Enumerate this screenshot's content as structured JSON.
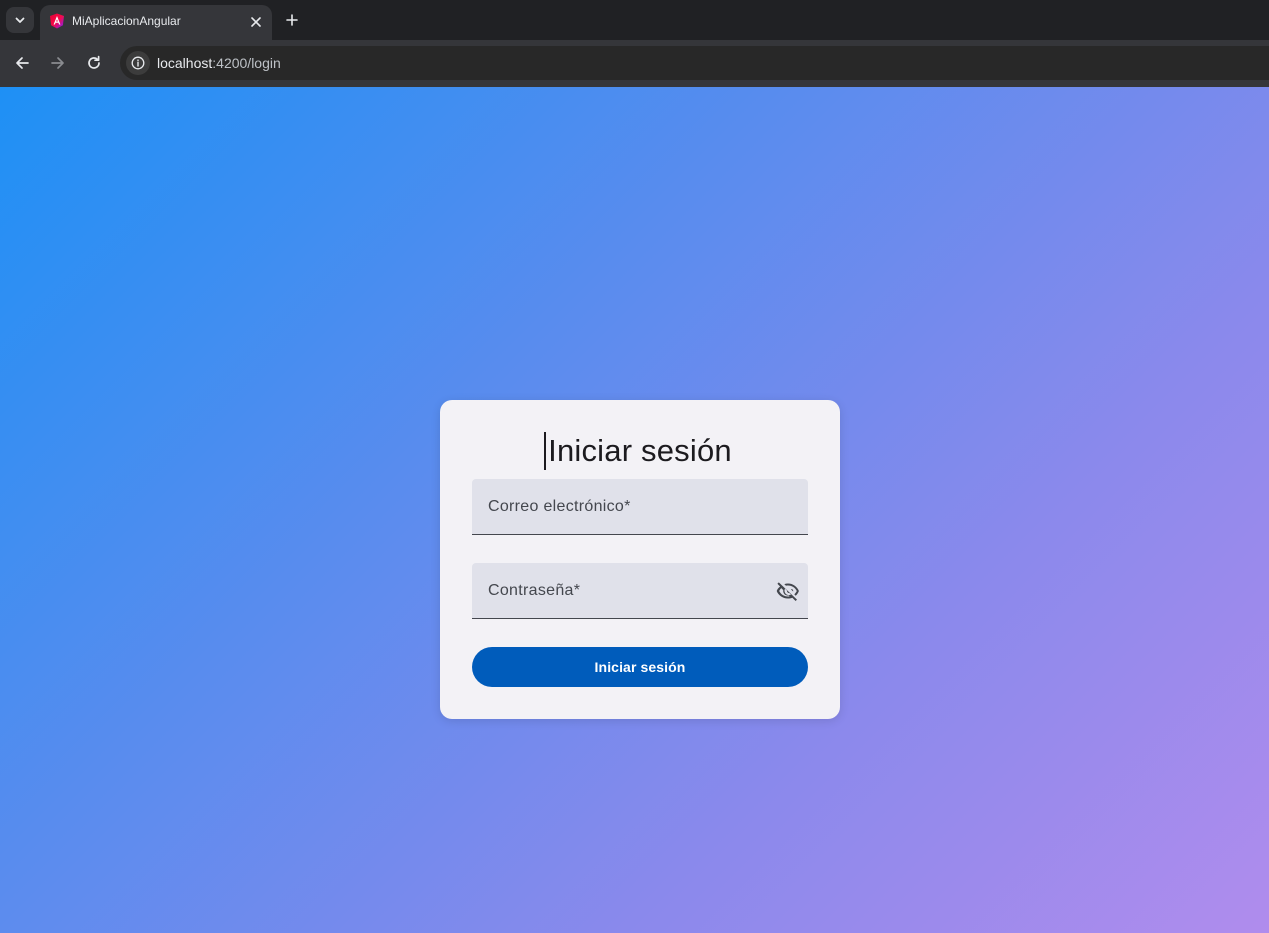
{
  "browser": {
    "tab": {
      "title": "MiAplicacionAngular",
      "favicon": "angular-logo-icon"
    },
    "address": {
      "host": "localhost",
      "path": ":4200/login"
    },
    "icons": {
      "tab_search": "chevron-down-icon",
      "tab_close": "close-icon",
      "new_tab": "plus-icon",
      "back": "arrow-left-icon",
      "forward": "arrow-right-icon",
      "reload": "reload-icon",
      "site_info": "info-icon"
    }
  },
  "login": {
    "title": "Iniciar sesión",
    "email_label": "Correo electrónico*",
    "password_label": "Contraseña*",
    "password_toggle_icon": "visibility-off-icon",
    "submit_label": "Iniciar sesión"
  },
  "colors": {
    "gradient_start": "#1e90f5",
    "gradient_end": "#b08ced",
    "card_bg": "#f3f2f6",
    "field_bg": "#e0e1ea",
    "primary_button": "#005cbb"
  }
}
